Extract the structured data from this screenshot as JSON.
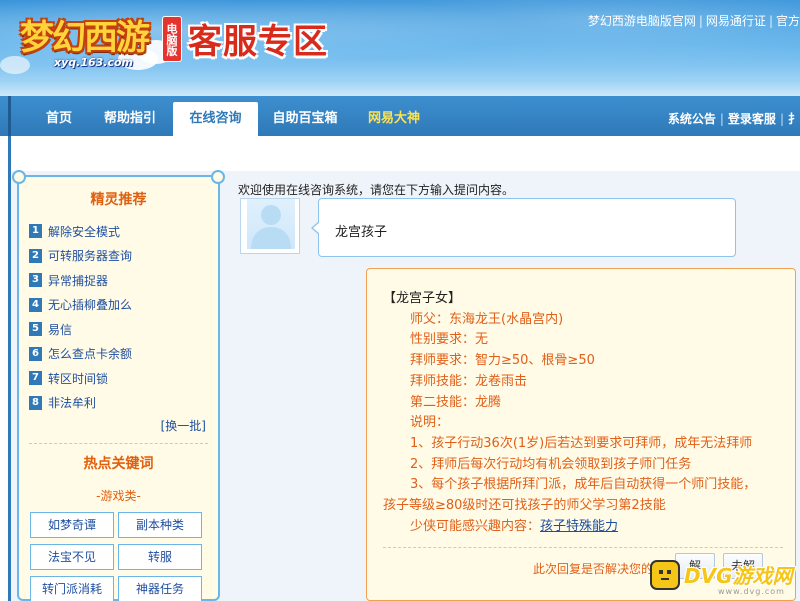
{
  "header": {
    "logo_text": "梦幻西游",
    "logo_badge": "电脑版",
    "logo_url": "xyq.163.com",
    "title": "客服专区",
    "top_links": [
      "梦幻西游电脑版官网",
      "网易通行证",
      "官方"
    ]
  },
  "nav": {
    "items": [
      {
        "label": "首页"
      },
      {
        "label": "帮助指引"
      },
      {
        "label": "在线咨询",
        "active": true
      },
      {
        "label": "自助百宝箱"
      },
      {
        "label": "网易大神",
        "highlight": true
      }
    ],
    "right_links": [
      "系统公告",
      "登录客服",
      "扌"
    ]
  },
  "sidebar": {
    "title": "精灵推荐",
    "items": [
      {
        "num": "1",
        "label": "解除安全模式"
      },
      {
        "num": "2",
        "label": "可转服务器查询"
      },
      {
        "num": "3",
        "label": "异常捕捉器"
      },
      {
        "num": "4",
        "label": "无心插柳叠加么"
      },
      {
        "num": "5",
        "label": "易信"
      },
      {
        "num": "6",
        "label": "怎么查点卡余额"
      },
      {
        "num": "7",
        "label": "转区时间锁"
      },
      {
        "num": "8",
        "label": "非法牟利"
      }
    ],
    "more": "[换一批]",
    "hot_title": "热点关键词",
    "hot_sub": "-游戏类-",
    "keywords": [
      "如梦奇谭",
      "副本种类",
      "法宝不见",
      "转服",
      "转门派消耗",
      "神器任务"
    ]
  },
  "main": {
    "welcome": "欢迎使用在线咨询系统，请您在下方输入提问内容。",
    "user_message": "龙宫孩子",
    "reply": {
      "title": "【龙宫子女】",
      "lines": [
        "师父：东海龙王(水晶宫内)",
        "性别要求：无",
        "拜师要求：智力≥50、根骨≥50",
        "拜师技能：龙卷雨击",
        "第二技能：龙腾",
        "说明：",
        "1、孩子行动36次(1岁)后若达到要求可拜师，成年无法拜师",
        "2、拜师后每次行动均有机会领取到孩子师门任务"
      ],
      "line3_part1": "3、每个孩子根据所拜门派，成年后自动获得一个师门技能，",
      "line3_part2": "孩子等级≥80级时还可找孩子的师父学习第2技能",
      "interest_label": "少侠可能感兴趣内容：",
      "interest_link": "孩子特殊能力",
      "footer_text": "此次回复是否解决您的疑",
      "btn_yes": "解",
      "btn_no": "未解"
    }
  },
  "watermark": {
    "text": "DVG游戏网",
    "sub": "www.dvg.com"
  },
  "colors": {
    "brand_blue": "#2f79b8",
    "accent_orange": "#e0601a",
    "link_blue": "#1f4fa0",
    "reply_bg": "#fffbe6"
  }
}
